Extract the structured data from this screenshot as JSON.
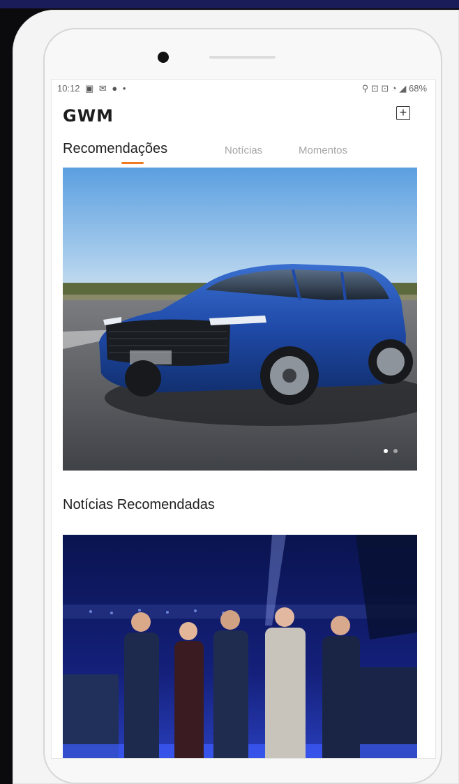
{
  "colors": {
    "accent": "#f07a1f",
    "car_body": "#1f4aa8",
    "sky": "#5ea2e0",
    "night_bg": "#0c1a66"
  },
  "status_bar": {
    "time": "10:12",
    "left_icons": "▣ ✉ ● •",
    "right_text": "⚲ ⊡ ⊡ ◔ ◢ 68%",
    "battery": "68%"
  },
  "header": {
    "logo_text": "GWM",
    "add_icon": "plus-square-icon",
    "add_symbol": "+"
  },
  "tabs": [
    {
      "label": "Recomendações",
      "active": true
    },
    {
      "label": "Notícias",
      "active": false
    },
    {
      "label": "Momentos",
      "active": false
    }
  ],
  "hero": {
    "image": "blue-suv-photo",
    "carousel_dots": 2,
    "active_dot": 0
  },
  "news": {
    "section_title": "Notícias Recomendadas",
    "image": "group-photo-at-night-event"
  }
}
